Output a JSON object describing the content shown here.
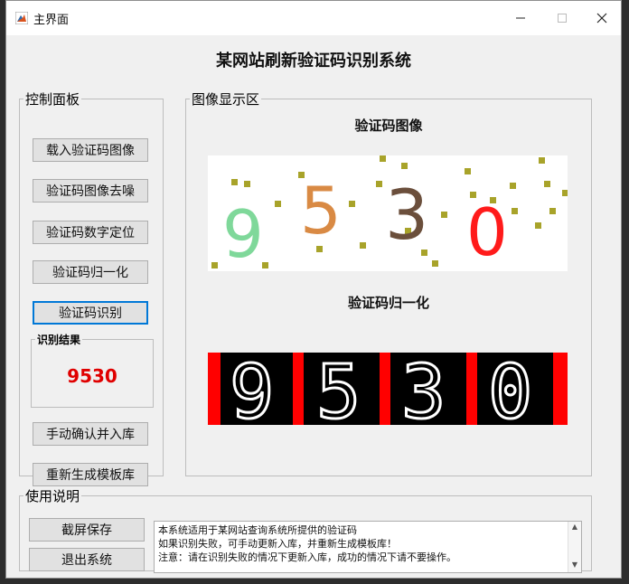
{
  "window": {
    "title": "主界面"
  },
  "app_title": "某网站刷新验证码识别系统",
  "control_panel": {
    "legend": "控制面板",
    "buttons": [
      "载入验证码图像",
      "验证码图像去噪",
      "验证码数字定位",
      "验证码归一化",
      "验证码识别"
    ],
    "result_legend": "识别结果",
    "result_value": "9530",
    "confirm_button": "手动确认并入库",
    "regen_button": "重新生成模板库"
  },
  "display": {
    "legend": "图像显示区",
    "captcha_caption": "验证码图像",
    "normalized_caption": "验证码归一化",
    "digits": [
      "9",
      "5",
      "3",
      "0"
    ],
    "digit_colors": [
      "#7fd89a",
      "#d98a44",
      "#6b4f3c",
      "#ff1b1b"
    ],
    "noise_color": "#a8a32a",
    "border_color": "#ff0000"
  },
  "help": {
    "legend": "使用说明",
    "screenshot_button": "截屏保存",
    "exit_button": "退出系统",
    "lines": [
      "本系统适用于某网站查询系统所提供的验证码",
      "如果识别失败，可手动更新入库，并重新生成模板库！",
      "注意：请在识别失败的情况下更新入库，成功的情况下请不要操作。"
    ]
  }
}
